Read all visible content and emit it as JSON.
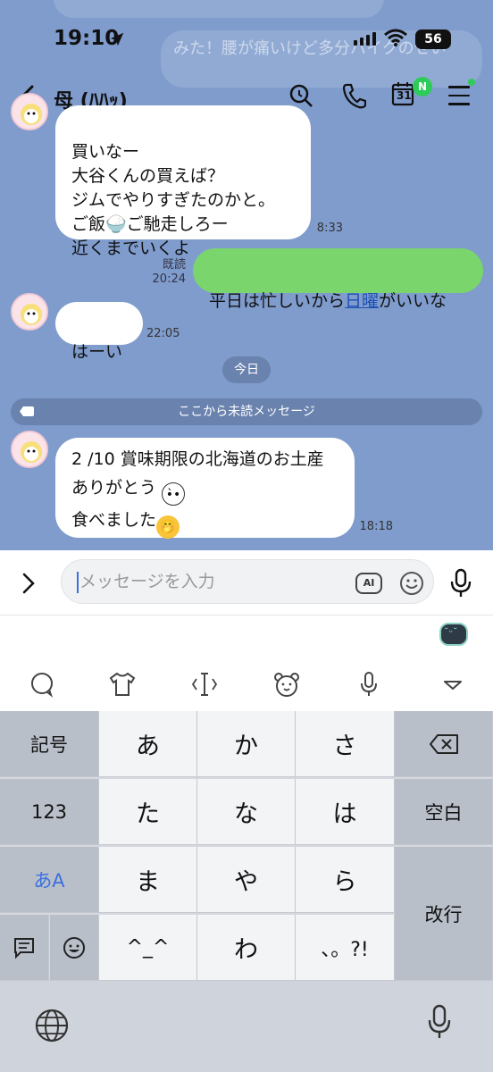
{
  "status_bar": {
    "time": "19:10",
    "battery": "56"
  },
  "background_messages": {
    "partial_1": "",
    "partial_2": "みた！腰が痛いけど多分バイクのせい"
  },
  "header": {
    "title": "母 (ﾊﾊｯ)",
    "calendar_day": "31",
    "calendar_badge": "N"
  },
  "messages": [
    {
      "id": "m1",
      "sender": "other",
      "text": "買いなー\n大谷くんの買えば？\nジムでやりすぎたのかと。\nご飯🍚ご馳走しろー\n近くまでいくよ",
      "time": "8:33"
    },
    {
      "id": "m2",
      "sender": "me",
      "text_before": "平日は忙しいから",
      "link": "日曜",
      "text_after": "がいいな",
      "read": "既読",
      "time": "20:24"
    },
    {
      "id": "m3",
      "sender": "other",
      "text": "はーい",
      "time": "22:05"
    },
    {
      "id": "m4",
      "sender": "other",
      "line1": "2 /10 賞味期限の北海道のお土産",
      "line2": "ありがとう",
      "line3": "食べました",
      "time": "18:18"
    }
  ],
  "date_separator": "今日",
  "unread_marker": "ここから未読メッセージ",
  "input": {
    "placeholder": "メッセージを入力",
    "ai_label": "AI"
  },
  "keyboard": {
    "left_keys": [
      "記号",
      "123",
      "あA"
    ],
    "rows": [
      [
        "あ",
        "か",
        "さ"
      ],
      [
        "た",
        "な",
        "は"
      ],
      [
        "ま",
        "や",
        "ら"
      ],
      [
        "^_^",
        "わ",
        "、。?!"
      ]
    ],
    "right_keys": [
      "⌫",
      "空白",
      "改行"
    ]
  },
  "colors": {
    "chat_bg": "#7f9ccd",
    "my_bubble": "#7ad56d",
    "link": "#1d4fb3",
    "badge": "#2fcb5a"
  }
}
